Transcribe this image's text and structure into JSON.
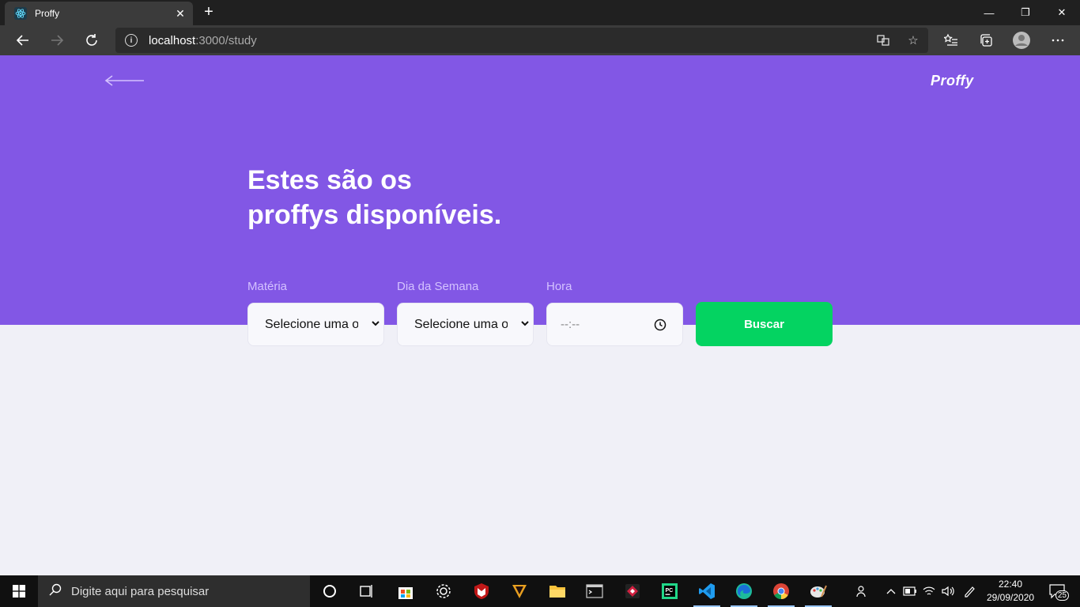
{
  "browser": {
    "tab_title": "Proffy",
    "tab_close": "✕",
    "new_tab": "+",
    "url_host": "localhost",
    "url_path": ":3000/study",
    "win_minimize": "—",
    "win_restore": "❐",
    "win_close": "✕"
  },
  "page": {
    "logo": "Proffy",
    "title_line1": "Estes são os",
    "title_line2": "proffys disponíveis.",
    "filters": {
      "subject_label": "Matéria",
      "subject_value": "Selecione uma opção",
      "weekday_label": "Dia da Semana",
      "weekday_value": "Selecione uma opção",
      "time_label": "Hora",
      "time_placeholder": "--:--"
    },
    "search_button": "Buscar",
    "colors": {
      "primary": "#8257e5",
      "secondary": "#04d361",
      "background": "#f0f0f7"
    }
  },
  "taskbar": {
    "search_placeholder": "Digite aqui para pesquisar",
    "time": "22:40",
    "date": "29/09/2020",
    "notifications": "25"
  }
}
